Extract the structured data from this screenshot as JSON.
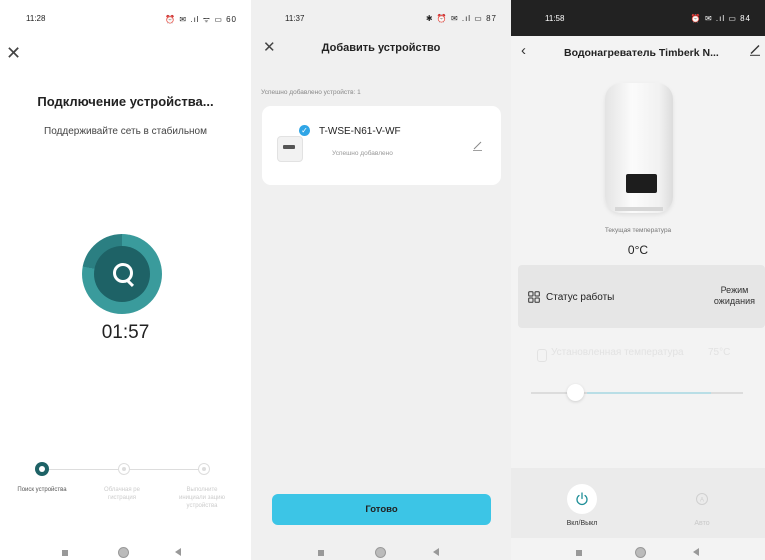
{
  "screens": {
    "connecting": {
      "status_time": "11:28",
      "status_icons": "⏰ ✉ .ıl ᯤ ▭ 60",
      "title": "Подключение устройства...",
      "subtitle": "Поддерживайте сеть в стабильном",
      "timer": "01:57",
      "steps": [
        {
          "label": "Поиск устройства",
          "state": "active"
        },
        {
          "label": "Облачная ре гистрация",
          "state": "pending"
        },
        {
          "label": "Выполните инициали зацию устройства",
          "state": "pending"
        }
      ],
      "progress": 0.78
    },
    "add_device": {
      "status_time": "11:37",
      "status_icons": "✱ ⏰ ✉ .ıl ▭ 87",
      "title": "Добавить устройство",
      "success_info": "Успешно добавлено устройств: 1",
      "device": {
        "name": "T-WSE-N61-V-WF",
        "status": "Успешно добавлено"
      },
      "done_label": "Готово"
    },
    "device_control": {
      "status_time": "11:58",
      "status_icons": "⏰ ✉ .ıl ▭ 84",
      "title": "Водонагреватель Timberk N...",
      "current_temp_label": "Текущая температура",
      "current_temp_value": "0°C",
      "work_status_label": "Статус работы",
      "work_status_value": [
        "Режим",
        "ожидания"
      ],
      "set_temp_label": "Установленная температура",
      "set_temp_value": "75°C",
      "slider_value": 0.17,
      "power_label": "Вкл/Выкл",
      "auto_label": "Авто"
    }
  },
  "colors": {
    "accent_teal": "#1e6266",
    "done_button": "#3cc5e6",
    "check_badge": "#2fa5e6",
    "power_icon": "#1f8f98"
  },
  "icons": [
    "close-icon",
    "search-icon",
    "check-icon",
    "edit-icon",
    "back-icon",
    "grid-icon",
    "thermometer-icon",
    "power-icon",
    "auto-icon"
  ]
}
